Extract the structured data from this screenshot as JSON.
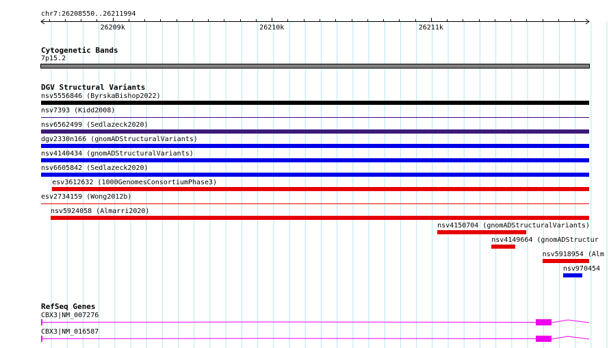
{
  "coord_label": "chr7:26208550..26211994",
  "ruler_ticks": [
    {
      "label": "26209k",
      "pos": 26209000
    },
    {
      "label": "26210k",
      "pos": 26210000
    },
    {
      "label": "26211k",
      "pos": 26211000
    }
  ],
  "range": {
    "start": 26208550,
    "end": 26211994
  },
  "cytoband_track": {
    "title": "Cytogenetic Bands",
    "band_label": "7p15.2",
    "color": "#808080"
  },
  "dgv_track": {
    "title": "DGV Structural Variants",
    "items": [
      {
        "label": "nsv5556846 (ByrskaBishop2022)",
        "start": 26208550,
        "end": 26211994,
        "color": "#000000",
        "thick": true
      },
      {
        "label": "nsv7393 (Kidd2008)",
        "start": 26208550,
        "end": 26211994,
        "color": "#3c0080",
        "thick": false
      },
      {
        "label": "nsv6562499 (Sedlazeck2020)",
        "start": 26208550,
        "end": 26211994,
        "color": "#3c1a78",
        "thick": true
      },
      {
        "label": "dgv2330n166 (gnomADStructuralVariants)",
        "start": 26208550,
        "end": 26211994,
        "color": "#0000e6",
        "thick": true
      },
      {
        "label": "nsv4140434 (gnomADStructuralVariants)",
        "start": 26208550,
        "end": 26211994,
        "color": "#0000e6",
        "thick": true
      },
      {
        "label": "nsv6605842 (Sedlazeck2020)",
        "start": 26208550,
        "end": 26211994,
        "color": "#0000e6",
        "thick": true
      },
      {
        "label": "esv3612632 (1000GenomesConsortiumPhase3)",
        "start": 26208620,
        "end": 26211994,
        "color": "#e60000",
        "thick": true
      },
      {
        "label": "esv2734159 (Wong2012b)",
        "start": 26208550,
        "end": 26211994,
        "color": "#e60000",
        "thick": false
      },
      {
        "label": "nsv5924058 (Almarri2020)",
        "start": 26208610,
        "end": 26211994,
        "color": "#e60000",
        "thick": true
      },
      {
        "label": "nsv4150704 (gnomADStructuralVariants)",
        "start": 26211040,
        "end": 26211600,
        "color": "#e60000",
        "thick": true
      },
      {
        "label": "nsv4149664 (gnomADStructur",
        "start": 26211380,
        "end": 26211530,
        "color": "#e60000",
        "thick": true
      },
      {
        "label": "nsv5918954 (Alm",
        "start": 26211700,
        "end": 26211994,
        "color": "#e60000",
        "thick": true
      },
      {
        "label": "nsv970454",
        "start": 26211830,
        "end": 26211950,
        "color": "#0000e6",
        "thick": true
      }
    ]
  },
  "refseq_track": {
    "title": "RefSeq Genes",
    "color": "#ee00ee",
    "items": [
      {
        "label": "CBX3|NM_007276"
      },
      {
        "label": "CBX3|NM_016587"
      }
    ]
  }
}
